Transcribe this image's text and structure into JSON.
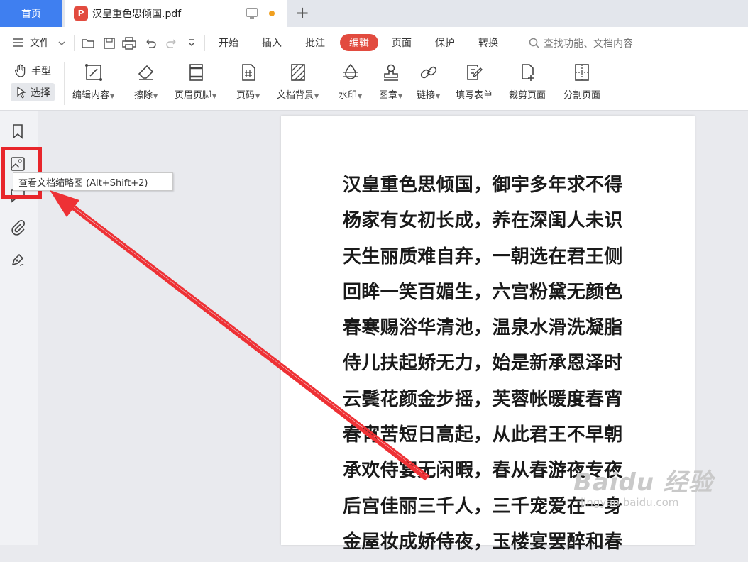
{
  "tabs": {
    "home": "首页",
    "document": "汉皇重色思倾国.pdf",
    "pdf_badge": "P"
  },
  "menu": {
    "file": "文件",
    "items": [
      "开始",
      "插入",
      "批注",
      "编辑",
      "页面",
      "保护",
      "转换"
    ],
    "active": "编辑",
    "search_placeholder": "查找功能、文档内容"
  },
  "toolbar": {
    "hand": "手型",
    "select": "选择",
    "buttons": [
      "编辑内容",
      "擦除",
      "页眉页脚",
      "页码",
      "文档背景",
      "水印",
      "图章",
      "链接",
      "填写表单",
      "裁剪页面",
      "分割页面"
    ]
  },
  "tooltip": "查看文档缩略图 (Alt+Shift+2)",
  "poem": [
    "汉皇重色思倾国，御宇多年求不得",
    "杨家有女初长成，养在深闺人未识",
    "天生丽质难自弃，一朝选在君王侧",
    "回眸一笑百媚生，六宫粉黛无颜色",
    "春寒赐浴华清池，温泉水滑洗凝脂",
    "侍儿扶起娇无力，始是新承恩泽时",
    "云鬓花颜金步摇，芙蓉帐暖度春宵",
    "春宵苦短日高起，从此君王不早朝",
    "承欢侍宴无闲暇，春从春游夜专夜",
    "后宫佳丽三千人，三千宠爱在一身",
    "金屋妆成娇侍夜，玉楼宴罢醉和春"
  ],
  "watermark": {
    "brand": "Baidu 经验",
    "url": "jingyan.baidu.com"
  },
  "colors": {
    "accent_blue": "#3f7ff0",
    "edit_red": "#e24b3f",
    "annotation_red": "#e8262b"
  }
}
